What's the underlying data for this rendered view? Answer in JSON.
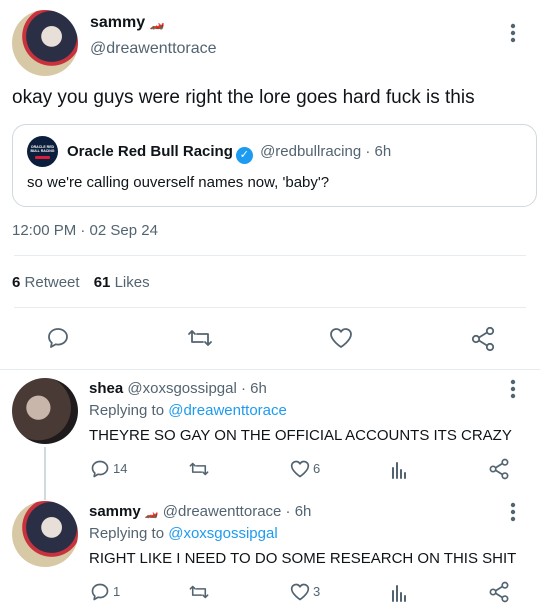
{
  "main_tweet": {
    "display_name": "sammy",
    "name_emoji": "🏎️",
    "handle": "@dreawenttorace",
    "text": "okay you guys were right the lore goes hard fuck is this",
    "timestamp": "12:00 PM · 02 Sep 24",
    "retweet_count": "6",
    "retweet_label": "Retweet",
    "likes_count": "61",
    "likes_label": "Likes"
  },
  "quoted_tweet": {
    "display_name": "Oracle Red Bull Racing",
    "handle": "@redbullracing",
    "time": "· 6h",
    "text": "so we're calling ouverself names now, 'baby'?",
    "avatar_text": "ORACLE RED BULL RACING"
  },
  "replies": [
    {
      "display_name": "shea",
      "handle": "@xoxsgossipgal",
      "time": "· 6h",
      "replying_to_label": "Replying to",
      "replying_to_handle": "@dreawenttorace",
      "text": "THEYRE SO GAY ON THE OFFICIAL ACCOUNTS ITS CRAZY",
      "reply_count": "14",
      "retweet_count": "",
      "like_count": "6"
    },
    {
      "display_name": "sammy",
      "name_emoji": "🏎️",
      "handle": "@dreawenttorace",
      "time": "· 6h",
      "replying_to_label": "Replying to",
      "replying_to_handle": "@xoxsgossipgal",
      "text": "RIGHT LIKE I NEED TO DO SOME RESEARCH ON THIS SHIT",
      "reply_count": "1",
      "retweet_count": "",
      "like_count": "3"
    }
  ],
  "colors": {
    "accent": "#1d9bf0",
    "secondary_text": "#536471",
    "divider": "#e6ecf0"
  },
  "icons": [
    "reply-icon",
    "retweet-icon",
    "like-icon",
    "share-icon",
    "analytics-icon",
    "more-options-icon",
    "verified-badge-icon"
  ]
}
